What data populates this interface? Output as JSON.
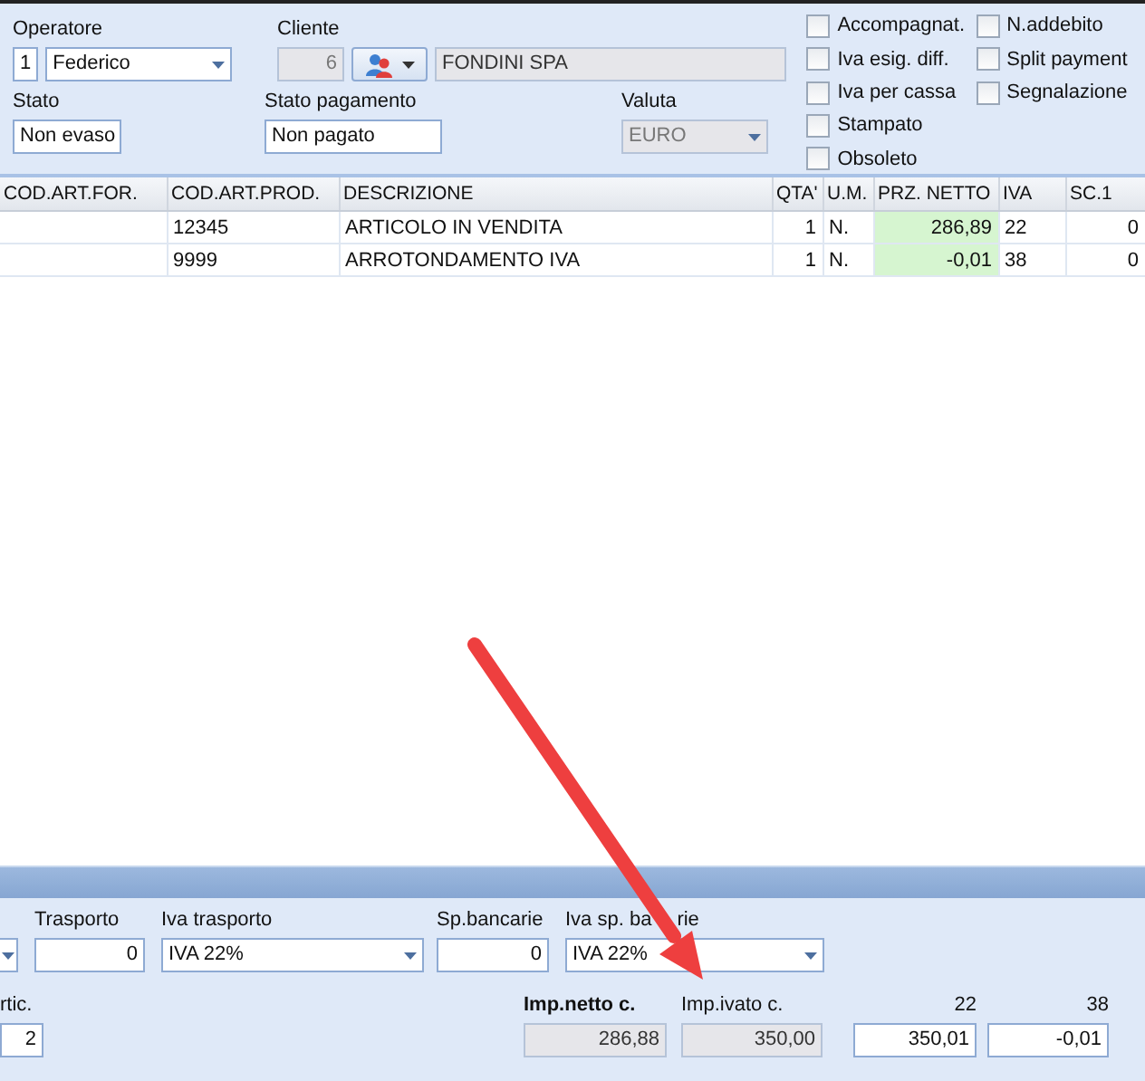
{
  "operator": {
    "label": "Operatore",
    "code": "1",
    "name": "Federico"
  },
  "client": {
    "label": "Cliente",
    "code": "6",
    "name": "FONDINI SPA",
    "disabled": true
  },
  "status": {
    "label": "Stato",
    "value": "Non evaso"
  },
  "payment_status": {
    "label": "Stato pagamento",
    "value": "Non pagato"
  },
  "currency": {
    "label": "Valuta",
    "value": "EURO",
    "disabled": true
  },
  "flags": [
    {
      "label": "Accompagnat.",
      "checked": false
    },
    {
      "label": "Iva esig. diff.",
      "checked": false
    },
    {
      "label": "Iva per cassa",
      "checked": false
    },
    {
      "label": "Stampato",
      "checked": false
    },
    {
      "label": "Obsoleto",
      "checked": false
    },
    {
      "label": "N.addebito",
      "checked": false
    },
    {
      "label": "Split payment",
      "checked": false
    },
    {
      "label": "Segnalazione",
      "checked": false
    }
  ],
  "table": {
    "columns": [
      {
        "label": "COD.ART.FOR.",
        "highlight": false
      },
      {
        "label": "COD.ART.PROD.",
        "highlight": false
      },
      {
        "label": "DESCRIZIONE",
        "highlight": false
      },
      {
        "label": "QTA'",
        "highlight": false
      },
      {
        "label": "U.M.",
        "highlight": false
      },
      {
        "label": "PRZ. NETTO",
        "highlight": true
      },
      {
        "label": "IVA",
        "highlight": false
      },
      {
        "label": "SC.1",
        "highlight": false
      }
    ],
    "rows": [
      {
        "cells": [
          null,
          "12345",
          "ARTICOLO IN VENDITA",
          "1",
          "N.",
          "286,89",
          "22",
          "0"
        ]
      },
      {
        "cells": [
          null,
          "9999",
          "ARROTONDAMENTO IVA",
          "1",
          "N.",
          "-0,01",
          "38",
          "0"
        ]
      }
    ]
  },
  "footer": {
    "transport": {
      "label": "Trasporto",
      "value": "0"
    },
    "transport_vat": {
      "label": "Iva trasporto",
      "value": "IVA 22%"
    },
    "bank_charges": {
      "label": "Sp.bancarie",
      "value": "0"
    },
    "bank_charges_vat": {
      "label_parts": [
        "Iva sp. ba",
        "rie"
      ],
      "value": "IVA 22%"
    },
    "articles": {
      "label": "rtic.",
      "value": "2"
    },
    "net_amount": {
      "label": "Imp.netto c.",
      "value": "286,88",
      "disabled": true
    },
    "gross_amount": {
      "label": "Imp.ivato c.",
      "value": "350,00",
      "disabled": true
    },
    "vat_breakdown": [
      {
        "label": "22",
        "value": "350,01"
      },
      {
        "label": "38",
        "value": "-0,01"
      }
    ]
  }
}
